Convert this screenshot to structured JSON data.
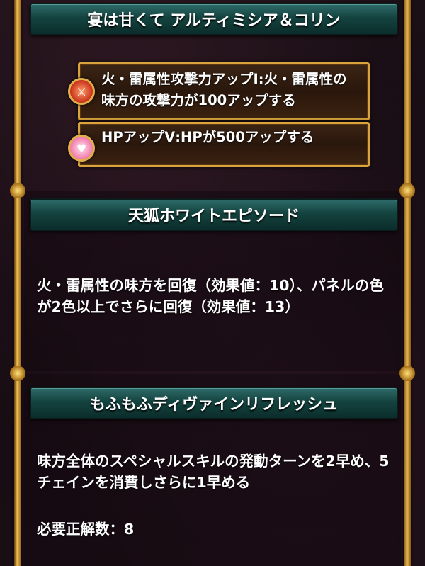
{
  "sections": {
    "leader": {
      "title": "宴は甘くて アルティミシア＆コリン",
      "skills": [
        {
          "icon": "attack-up-icon",
          "text": "火・雷属性攻撃力アップⅠ:火・雷属性の味方の攻撃力が100アップする"
        },
        {
          "icon": "hp-up-icon",
          "text": "HPアップⅤ:HPが500アップする"
        }
      ]
    },
    "answer_skill": {
      "title": "天狐ホワイトエピソード",
      "description": "火・雷属性の味方を回復（効果値：10）、パネルの色が2色以上でさらに回復（効果値：13）"
    },
    "special_skill": {
      "title": "もふもふディヴァインリフレッシュ",
      "description": "味方全体のスペシャルスキルの発動ターンを2早め、5チェインを消費しさらに1早める",
      "required_label": "必要正解数：8"
    }
  },
  "colors": {
    "header": "#14433f",
    "frame_gold": "#f0c050",
    "card_bg": "#2a170c",
    "text": "#ffffff"
  }
}
